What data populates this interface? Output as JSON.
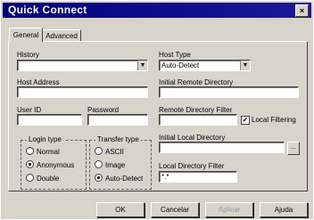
{
  "window": {
    "title": "Quick Connect",
    "close_glyph": "×"
  },
  "tabs": [
    {
      "label": "General",
      "active": true
    },
    {
      "label": "Advanced",
      "active": false
    }
  ],
  "left": {
    "history_label": "History",
    "history_value": "",
    "host_address_label": "Host Address",
    "host_address_value": "",
    "user_id_label": "User ID",
    "user_id_value": "",
    "password_label": "Password",
    "password_value": ""
  },
  "login_type": {
    "title": "Login type",
    "options": [
      "Normal",
      "Anonymous",
      "Double"
    ],
    "selected": "Anonymous"
  },
  "transfer_type": {
    "title": "Transfer type",
    "options": [
      "ASCII",
      "Image",
      "Auto-Detect"
    ],
    "selected": "Auto-Detect"
  },
  "right": {
    "host_type_label": "Host Type",
    "host_type_value": "Auto-Detect",
    "initial_remote_dir_label": "Initial Remote Directory",
    "initial_remote_dir_value": "",
    "remote_filter_label": "Remote Directory Filter",
    "remote_filter_value": "",
    "local_filtering_label": "Local Filtering",
    "local_filtering_checked": true,
    "initial_local_dir_label": "Initial Local Directory",
    "initial_local_dir_value": "",
    "browse_glyph": "...",
    "local_filter_label": "Local Directory Filter",
    "local_filter_value": "*.*"
  },
  "buttons": {
    "ok": "OK",
    "cancel": "Cancelar",
    "apply": "Aplicar",
    "help": "Ajuda"
  },
  "colors": {
    "titlebar": "#00007a",
    "face": "#d8d4cc"
  }
}
